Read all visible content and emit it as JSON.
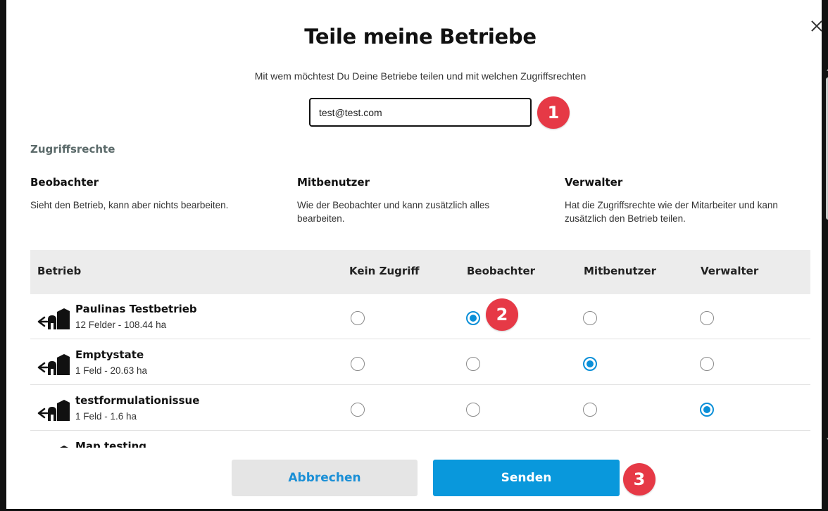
{
  "dialog": {
    "title": "Teile meine Betriebe",
    "subtitle": "Mit wem möchtest Du Deine Betriebe teilen und mit welchen Zugriffsrechten",
    "email_value": "test@test.com",
    "access_section_label": "Zugriffsrechte"
  },
  "roles": [
    {
      "title": "Beobachter",
      "description": "Sieht den Betrieb, kann aber nichts bearbeiten."
    },
    {
      "title": "Mitbenutzer",
      "description": "Wie der Beobachter und kann zusätzlich alles bearbeiten."
    },
    {
      "title": "Verwalter",
      "description": "Hat die Zugriffsrechte wie der Mitarbeiter und kann zusätzlich den Betrieb teilen."
    }
  ],
  "table": {
    "headers": [
      "Betrieb",
      "Kein Zugriff",
      "Beobachter",
      "Mitbenutzer",
      "Verwalter"
    ],
    "rows": [
      {
        "name": "Paulinas Testbetrieb",
        "info": "12 Felder - 108.44 ha",
        "selected": "Beobachter"
      },
      {
        "name": "Emptystate",
        "info": "1 Feld - 20.63 ha",
        "selected": "Mitbenutzer"
      },
      {
        "name": "testformulationissue",
        "info": "1 Feld - 1.6 ha",
        "selected": "Verwalter"
      },
      {
        "name": "Map testing",
        "info": "",
        "selected": ""
      }
    ]
  },
  "buttons": {
    "cancel": "Abbrechen",
    "send": "Senden"
  },
  "markers": [
    "1",
    "2",
    "3"
  ],
  "colors": {
    "accent": "#0998dc",
    "marker": "#e63946",
    "header_bg": "#ececec"
  }
}
